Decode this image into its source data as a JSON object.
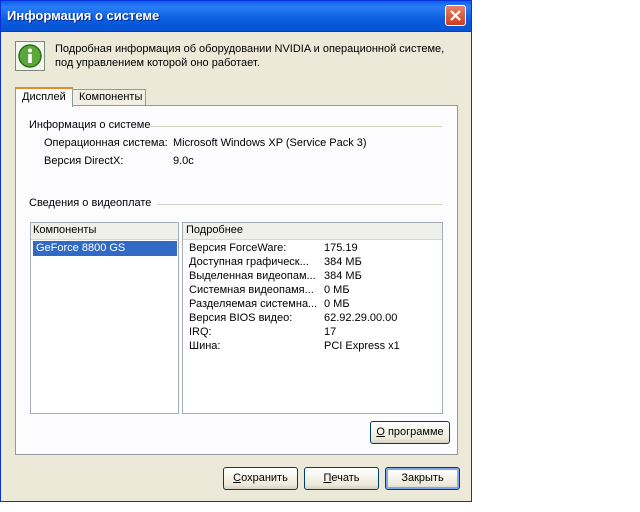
{
  "window": {
    "title": "Информация о системе"
  },
  "header": {
    "icon": "info-icon",
    "text": "Подробная информация об оборудовании NVIDIA и операционной системе, под управлением которой оно работает."
  },
  "tabs": [
    {
      "label": "Дисплей",
      "active": true
    },
    {
      "label": "Компоненты",
      "active": false
    }
  ],
  "system_info": {
    "title": "Информация о системе",
    "rows": [
      {
        "label": "Операционная система:",
        "value": "Microsoft Windows XP (Service Pack 3)"
      },
      {
        "label": "Версия DirectX:",
        "value": "9.0c"
      }
    ]
  },
  "video_info": {
    "title": "Сведения о видеоплате",
    "components_header": "Компоненты",
    "details_header": "Подробнее",
    "components": [
      "GeForce 8800 GS"
    ],
    "details": [
      {
        "label": "Версия ForceWare:",
        "value": "175.19"
      },
      {
        "label": "Доступная графическ...",
        "value": "384 МБ"
      },
      {
        "label": "Выделенная видеопам...",
        "value": "384 МБ"
      },
      {
        "label": "Системная видеопамя...",
        "value": "0 МБ"
      },
      {
        "label": "Разделяемая системна...",
        "value": "0 МБ"
      },
      {
        "label": "Версия BIOS видео:",
        "value": "62.92.29.00.00"
      },
      {
        "label": "IRQ:",
        "value": "17"
      },
      {
        "label": "Шина:",
        "value": "PCI Express x1"
      }
    ]
  },
  "buttons": {
    "about": {
      "accel": "О",
      "rest": " программе"
    },
    "save": {
      "accel": "С",
      "rest": "охранить"
    },
    "print": {
      "accel": "П",
      "rest": "ечать"
    },
    "close": "Закрыть"
  }
}
